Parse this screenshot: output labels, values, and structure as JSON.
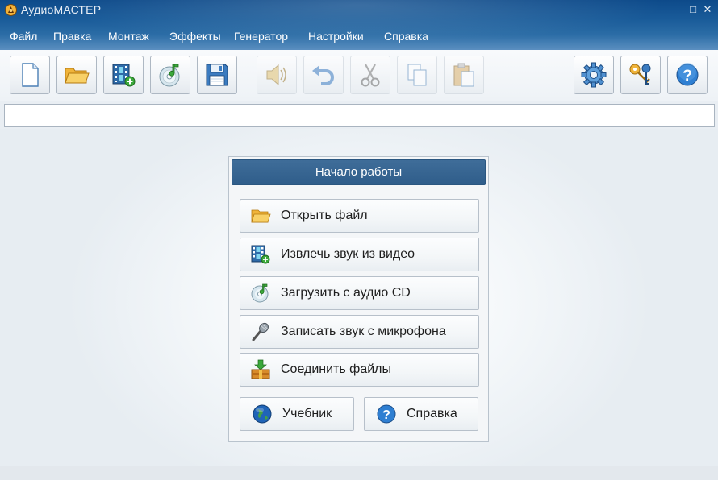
{
  "window": {
    "title": "АудиоМАСТЕР",
    "controls": {
      "minimize": "–",
      "maximize": "□",
      "close": "✕"
    }
  },
  "menu": [
    "Файл",
    "Правка",
    "Монтаж",
    "Эффекты",
    "Генератор",
    "Настройки",
    "Справка"
  ],
  "toolbar": {
    "buttons": [
      {
        "icon": "new-file-icon",
        "enabled": true
      },
      {
        "icon": "open-folder-icon",
        "enabled": true
      },
      {
        "icon": "extract-from-video-icon",
        "enabled": true
      },
      {
        "icon": "audio-cd-icon",
        "enabled": true
      },
      {
        "icon": "save-icon",
        "enabled": true
      },
      {
        "icon": "speaker-icon",
        "enabled": false
      },
      {
        "icon": "undo-icon",
        "enabled": false
      },
      {
        "icon": "cut-icon",
        "enabled": false
      },
      {
        "icon": "copy-icon",
        "enabled": false
      },
      {
        "icon": "paste-icon",
        "enabled": false
      },
      {
        "icon": "settings-gear-icon",
        "enabled": true
      },
      {
        "icon": "keys-icon",
        "enabled": true
      },
      {
        "icon": "help-icon",
        "enabled": true
      }
    ]
  },
  "start_panel": {
    "title": "Начало работы",
    "actions": [
      {
        "label": "Открыть файл",
        "icon": "open-folder-icon"
      },
      {
        "label": "Извлечь звук из видео",
        "icon": "video-film-icon"
      },
      {
        "label": "Загрузить с аудио CD",
        "icon": "audio-cd-icon"
      },
      {
        "label": "Записать звук с микрофона",
        "icon": "microphone-icon"
      },
      {
        "label": "Соединить файлы",
        "icon": "join-files-icon"
      }
    ],
    "tutorial": {
      "label": "Учебник",
      "icon": "globe-icon"
    },
    "help": {
      "label": "Справка",
      "icon": "help-icon"
    }
  },
  "colors": {
    "header_dark": "#0d4a8a",
    "panel_title_bg": "#2f5d8a",
    "accent_orange": "#f0a020"
  }
}
